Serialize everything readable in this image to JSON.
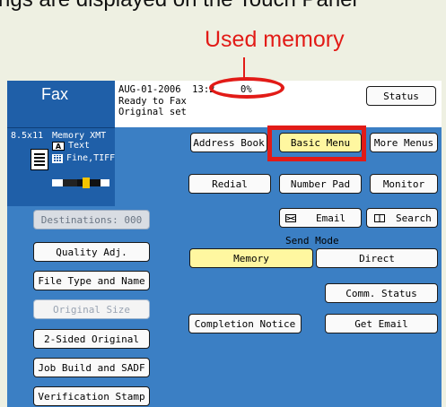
{
  "heading_partial": "ngs are displayed on the Touch Panel",
  "callout": "Used memory",
  "header": {
    "app_title": "Fax",
    "status_lines": "AUG-01-2006  13:2\nReady to Fax\nOriginal set",
    "memory_percent": "0%",
    "status_button": "Status"
  },
  "info": {
    "size": "8.5x11",
    "memory": "Memory XMT",
    "text_mode": "Text",
    "resolution": "Fine,TIFF",
    "text_mode_icon": "letter-a-icon",
    "resolution_icon": "grid-icon",
    "contrast_level": 0.55
  },
  "tabs": {
    "address_book": "Address Book",
    "basic_menu": "Basic Menu",
    "more_menus": "More Menus"
  },
  "actions": {
    "redial": "Redial",
    "number_pad": "Number Pad",
    "monitor": "Monitor",
    "email": "Email",
    "search": "Search",
    "send_mode_label": "Send Mode",
    "memory": "Memory",
    "direct": "Direct",
    "comm_status": "Comm. Status",
    "completion_notice": "Completion Notice",
    "get_email": "Get Email"
  },
  "sidebar": {
    "destinations": "Destinations: 000",
    "items": [
      "Quality Adj.",
      "File Type and Name",
      "Original Size",
      "2-Sided Original",
      "Job Build and SADF",
      "Verification Stamp"
    ]
  },
  "colors": {
    "panel_blue": "#3b7fc4",
    "header_blue": "#1f5fa8",
    "highlight_red": "#e21b17",
    "selected_yellow": "#fff7a0"
  }
}
